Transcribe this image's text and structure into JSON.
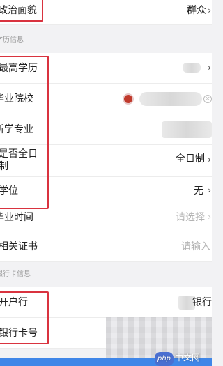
{
  "rows": {
    "political_status": {
      "label": "政治面貌",
      "value": "群众"
    },
    "highest_education": {
      "label": "最高学历"
    },
    "graduated_school": {
      "label": "毕业院校"
    },
    "major": {
      "label": "所学专业"
    },
    "full_time": {
      "label_line1": "是否全日",
      "label_line2": "制",
      "value": "全日制"
    },
    "degree": {
      "label": "学位",
      "value": "无"
    },
    "graduation_time": {
      "label": "毕业时间",
      "placeholder": "请选择"
    },
    "certificates": {
      "label": "相关证书",
      "placeholder": "请输入"
    },
    "bank": {
      "label": "开户行",
      "value_suffix": "银行"
    },
    "card_number": {
      "label": "银行卡号"
    }
  },
  "sections": {
    "education": "学历信息",
    "bank": "银行卡信息"
  },
  "watermark": {
    "badge": "php",
    "text": "中文网"
  },
  "colors": {
    "highlight": "#d9333f",
    "accent": "#3f86e8"
  }
}
